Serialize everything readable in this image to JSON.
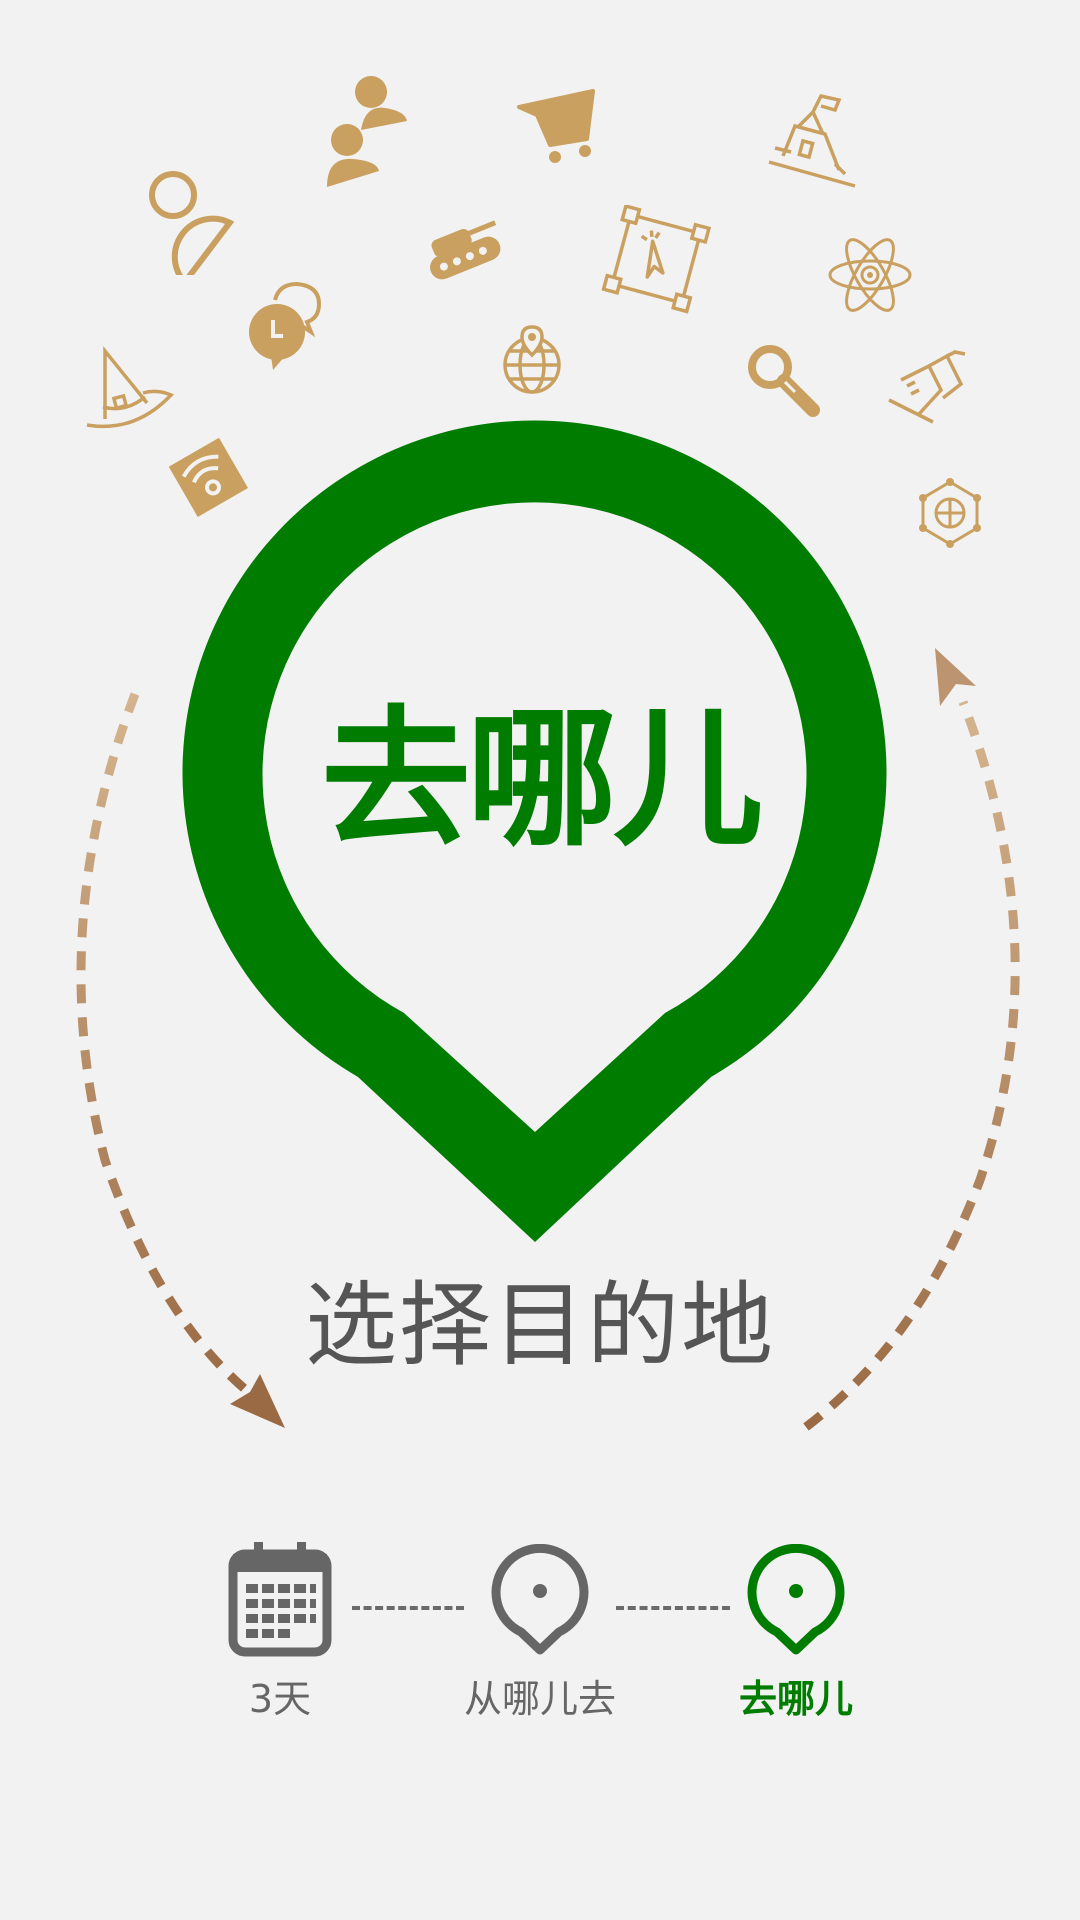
{
  "main": {
    "title": "去哪儿",
    "subtitle": "选择目的地"
  },
  "steps": [
    {
      "label": "3天",
      "icon": "calendar-icon",
      "state": "done"
    },
    {
      "label": "从哪儿去",
      "icon": "location-pin-icon",
      "state": "done"
    },
    {
      "label": "去哪儿",
      "icon": "location-pin-icon",
      "state": "active"
    }
  ],
  "floating_icons": [
    "user-outline-icon",
    "users-icon",
    "shopping-cart-icon",
    "school-building-icon",
    "tank-icon",
    "chat-bubbles-icon",
    "select-tool-icon",
    "atom-icon",
    "wizard-hat-icon",
    "globe-pin-icon",
    "magnifier-icon",
    "city-buildings-icon",
    "wifi-icon",
    "network-globe-icon"
  ],
  "colors": {
    "background": "#f2f2f2",
    "accent_green": "#007d00",
    "icon_gold": "#c9a05f",
    "arrow_tan": "#c8a27a",
    "step_gray": "#666666"
  }
}
